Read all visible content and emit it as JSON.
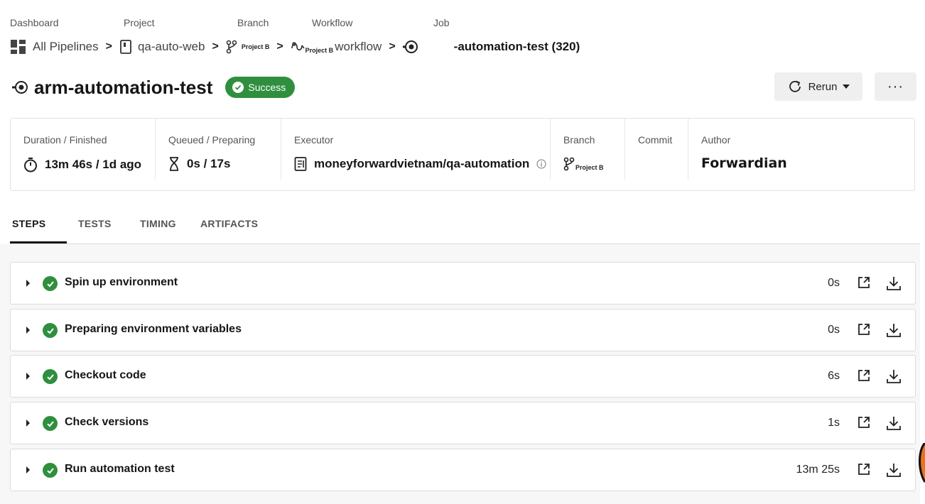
{
  "breadcrumb": {
    "labels": {
      "dashboard": "Dashboard",
      "project": "Project",
      "branch": "Branch",
      "workflow": "Workflow",
      "job": "Job"
    },
    "all_pipelines": "All Pipelines",
    "project_name": "qa-auto-web",
    "branch_name": "Project B",
    "workflow_name": "workflow",
    "workflow_sub": "Project B",
    "job_name": "-automation-test (320)",
    "separator": ">"
  },
  "header": {
    "title": "arm-automation-test",
    "status": "Success",
    "rerun_label": "Rerun",
    "more_label": "···"
  },
  "info": {
    "duration_label": "Duration / Finished",
    "duration_value": "13m 46s / 1d ago",
    "queued_label": "Queued / Preparing",
    "queued_value": "0s / 17s",
    "executor_label": "Executor",
    "executor_value": "moneyforwardvietnam/qa-automation",
    "branch_label": "Branch",
    "branch_value": "Project B",
    "commit_label": "Commit",
    "author_label": "Author",
    "author_value": "Forwardian"
  },
  "tabs": [
    "STEPS",
    "TESTS",
    "TIMING",
    "ARTIFACTS"
  ],
  "steps": [
    {
      "name": "Spin up environment",
      "duration": "0s"
    },
    {
      "name": "Preparing environment variables",
      "duration": "0s"
    },
    {
      "name": "Checkout code",
      "duration": "6s"
    },
    {
      "name": "Check versions",
      "duration": "1s"
    },
    {
      "name": "Run automation test",
      "duration": "13m 25s"
    }
  ],
  "colors": {
    "success": "#2f8f3e",
    "button_bg": "#efefef",
    "text": "#161616"
  }
}
